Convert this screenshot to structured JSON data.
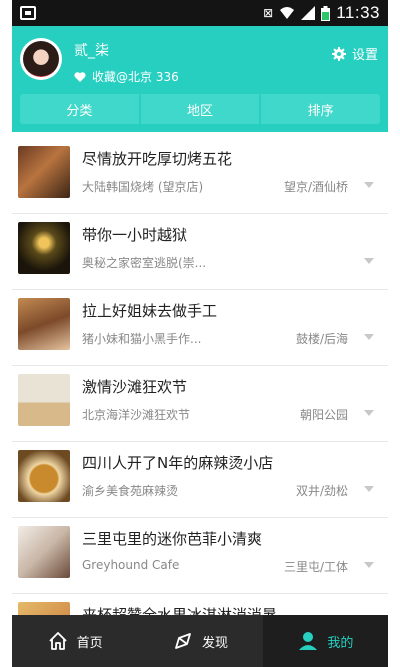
{
  "status_bar": {
    "time": "11:33"
  },
  "profile": {
    "name": "贰_柒",
    "favorites": "收藏@北京 336",
    "settings_label": "设置"
  },
  "segments": [
    "分类",
    "地区",
    "排序"
  ],
  "list": [
    {
      "title": "尽情放开吃厚切烤五花",
      "venue": "大陆韩国烧烤 (望京店)",
      "area": "望京/酒仙桥"
    },
    {
      "title": "带你一小时越狱",
      "venue": "奥秘之家密室逃脱(崇...",
      "area": ""
    },
    {
      "title": "拉上好姐妹去做手工",
      "venue": "猪小妹和猫小黑手作...",
      "area": "鼓楼/后海"
    },
    {
      "title": "激情沙滩狂欢节",
      "venue": "北京海洋沙滩狂欢节",
      "area": "朝阳公园"
    },
    {
      "title": "四川人开了N年的麻辣烫小店",
      "venue": "渝乡美食苑麻辣烫",
      "area": "双井/劲松"
    },
    {
      "title": "三里屯里的迷你芭菲小清爽",
      "venue": "Greyhound Cafe",
      "area": "三里屯/工体"
    },
    {
      "title": "来杯超赞全水果冰淇淋消消暑",
      "venue": "",
      "area": ""
    }
  ],
  "tabs": [
    {
      "label": "首页",
      "icon": "home-icon"
    },
    {
      "label": "发现",
      "icon": "compass-icon"
    },
    {
      "label": "我的",
      "icon": "user-icon"
    }
  ]
}
